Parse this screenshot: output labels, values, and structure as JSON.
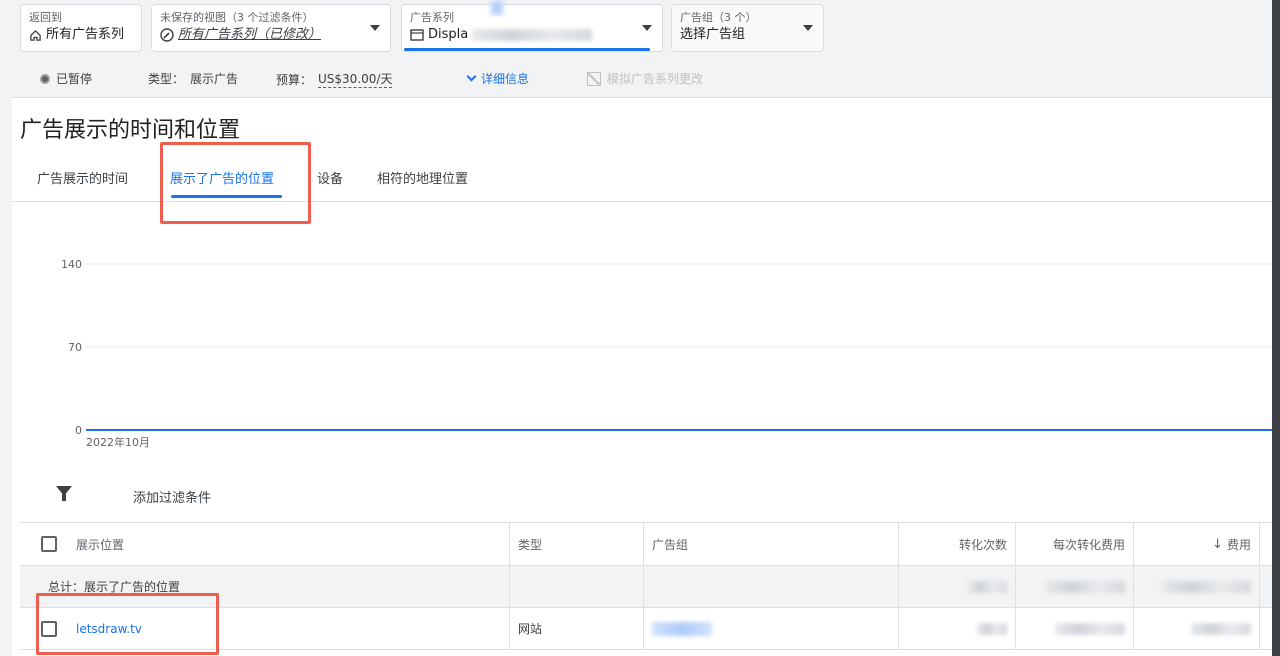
{
  "top_filters": {
    "back": {
      "label": "返回到",
      "value": "所有广告系列"
    },
    "view": {
      "label": "未保存的视图（3 个过滤条件）",
      "value": "所有广告系列（已修改）"
    },
    "campaign": {
      "label": "广告系列",
      "value": "Displa"
    },
    "ad_group": {
      "label": "广告组（3 个）",
      "value": "选择广告组"
    }
  },
  "status_row": {
    "status": "已暂停",
    "type_label": "类型：",
    "type_value": "展示广告",
    "budget_label": "预算：",
    "budget_value": "US$30.00/天",
    "details": "详细信息",
    "simulate": "模拟广告系列更改"
  },
  "page_title": "广告展示的时间和位置",
  "tabs": [
    {
      "label": "广告展示的时间"
    },
    {
      "label": "展示了广告的位置"
    },
    {
      "label": "设备"
    },
    {
      "label": "相符的地理位置"
    }
  ],
  "chart_data": {
    "type": "line",
    "x": [
      "2022年10月"
    ],
    "series": [
      {
        "values": [
          0
        ]
      }
    ],
    "yticks": [
      "140",
      "70",
      "0"
    ],
    "ylim": [
      0,
      140
    ],
    "grid": true
  },
  "filter_bar": {
    "label": "添加过滤条件"
  },
  "table": {
    "headers": {
      "placement": "展示位置",
      "type": "类型",
      "ad_group": "广告组",
      "conversions": "转化次数",
      "cost_per_conversion": "每次转化费用",
      "cost": "费用"
    },
    "total_label": "总计：展示了广告的位置",
    "rows": [
      {
        "placement": "letsdraw.tv",
        "type": "网站"
      }
    ]
  },
  "colors": {
    "accent": "#1a73e8",
    "highlight_box": "#ee5e4f"
  }
}
